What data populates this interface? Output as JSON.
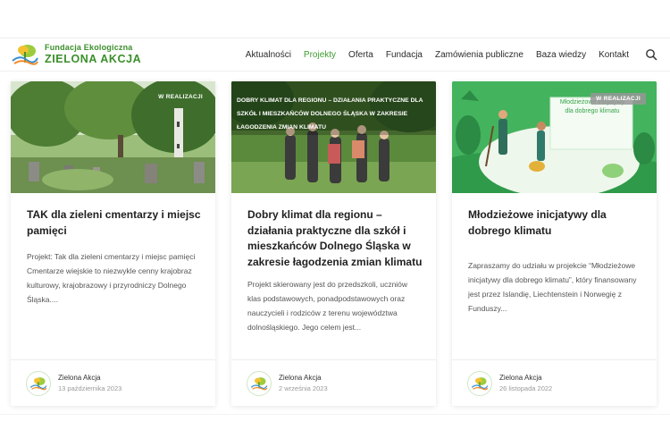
{
  "logo": {
    "line1": "Fundacja Ekologiczna",
    "line2": "ZIELONA AKCJA"
  },
  "nav": {
    "items": [
      {
        "label": "Aktualności",
        "active": false
      },
      {
        "label": "Projekty",
        "active": true
      },
      {
        "label": "Oferta",
        "active": false
      },
      {
        "label": "Fundacja",
        "active": false
      },
      {
        "label": "Zamówienia publiczne",
        "active": false
      },
      {
        "label": "Baza wiedzy",
        "active": false
      },
      {
        "label": "Kontakt",
        "active": false
      }
    ],
    "search_icon": "search-icon"
  },
  "colors": {
    "brand_green": "#3a8f2a",
    "active_nav": "#3d9c2f",
    "text": "#1f1f1f",
    "muted": "#9a9a9a"
  },
  "cards": [
    {
      "badge": "W REALIZACJI",
      "title": "TAK dla zieleni cmentarzy i miejsc pamięci",
      "excerpt": "Projekt: Tak dla zieleni cmentarzy i miejsc pamięci Cmentarze wiejskie to niezwykle cenny krajobraz kulturowy, krajobrazowy i przyrodniczy Dolnego Śląska....",
      "author": "Zielona Akcja",
      "date": "13 października 2023"
    },
    {
      "overlay": "DOBRY KLIMAT DLA REGIONU – DZIAŁANIA PRAKTYCZNE DLA SZKÓŁ I MIESZKAŃCÓW DOLNEGO ŚLĄSKA W ZAKRESIE ŁAGODZENIA ZMIAN KLIMATU",
      "title": "Dobry klimat dla regionu – działania praktyczne dla szkół i mieszkańców Dolnego Śląska w zakresie łagodzenia zmian klimatu",
      "excerpt": "Projekt skierowany jest do przedszkoli, uczniów klas podstawowych, ponadpodstawowych oraz nauczycieli i rodziców z terenu województwa dolnośląskiego. Jego celem jest...",
      "author": "Zielona Akcja",
      "date": "2 września 2023"
    },
    {
      "badge": "W REALIZACJI",
      "sign_text": "Młodzieżowe inicjatywy dla dobrego klimatu",
      "title": "Młodzieżowe inicjatywy dla dobrego klimatu",
      "excerpt": "Zapraszamy do udziału w projekcie “Młodzieżowe inicjatywy dla dobrego klimatu”, który finansowany jest przez Islandię, Liechtenstein i Norwegię z Funduszy...",
      "author": "Zielona Akcja",
      "date": "26 listopada 2022"
    }
  ]
}
